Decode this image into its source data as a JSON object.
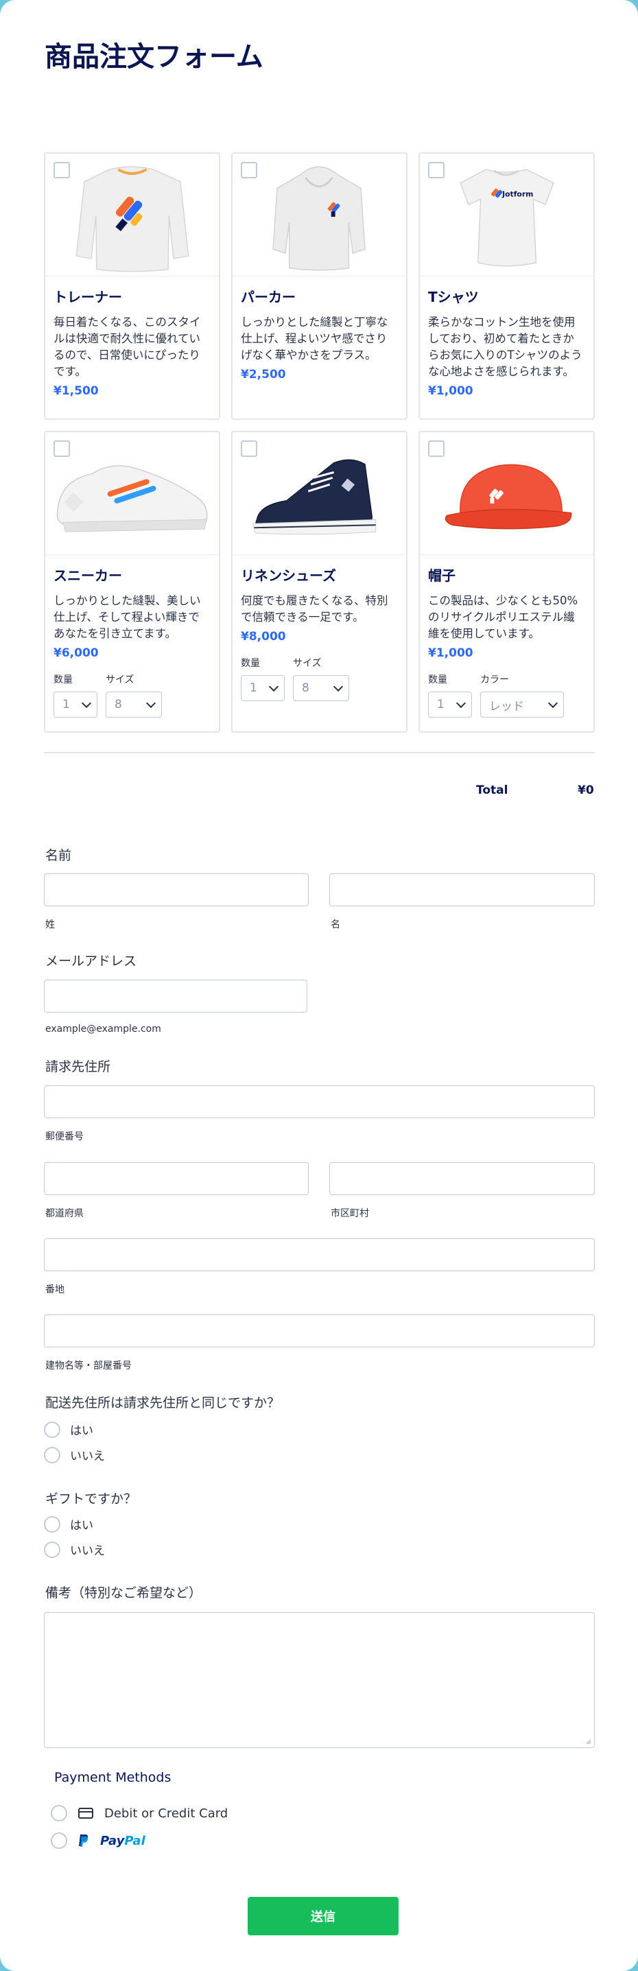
{
  "form": {
    "title": "商品注文フォーム"
  },
  "products": [
    {
      "name": "トレーナー",
      "desc": "毎日着たくなる、このスタイルは快適で耐久性に優れているので、日常使いにぴったりです。",
      "price": "¥1,500",
      "image": "sweatshirt"
    },
    {
      "name": "パーカー",
      "desc": "しっかりとした縫製と丁寧な仕上げ、程よいツヤ感でさりげなく華やかさをプラス。",
      "price": "¥2,500",
      "image": "hoodie"
    },
    {
      "name": "Tシャツ",
      "desc": "柔らかなコットン生地を使用しており、初めて着たときからお気に入りのTシャツのような心地よさを感じられます。",
      "price": "¥1,000",
      "image": "tshirt",
      "logo_text": "Jotform"
    },
    {
      "name": "スニーカー",
      "desc": "しっかりとした縫製、美しい仕上げ、そして程よい輝きであなたを引き立てます。",
      "price": "¥6,000",
      "image": "sneaker",
      "options": [
        {
          "label": "数量",
          "value": "1"
        },
        {
          "label": "サイズ",
          "value": "8"
        }
      ]
    },
    {
      "name": "リネンシューズ",
      "desc": "何度でも履きたくなる、特別で信頼できる一足です。",
      "price": "¥8,000",
      "image": "high-top-shoe",
      "options": [
        {
          "label": "数量",
          "value": "1"
        },
        {
          "label": "サイズ",
          "value": "8"
        }
      ]
    },
    {
      "name": "帽子",
      "desc": "この製品は、少なくとも50%のリサイクルポリエステル繊維を使用しています。",
      "price": "¥1,000",
      "image": "cap",
      "options": [
        {
          "label": "数量",
          "value": "1"
        },
        {
          "label": "カラー",
          "value": "レッド"
        }
      ]
    }
  ],
  "total": {
    "label": "Total",
    "value": "¥0"
  },
  "name_field": {
    "label": "名前",
    "last": "姓",
    "first": "名"
  },
  "email_field": {
    "label": "メールアドレス",
    "hint": "example@example.com"
  },
  "address_field": {
    "label": "請求先住所",
    "postal": "郵便番号",
    "prefecture": "都道府県",
    "city": "市区町村",
    "street": "番地",
    "building": "建物名等・部屋番号"
  },
  "shipping_same": {
    "label": "配送先住所は請求先住所と同じですか？",
    "options": [
      "はい",
      "いいえ"
    ]
  },
  "gift": {
    "label": "ギフトですか？",
    "options": [
      "はい",
      "いいえ"
    ]
  },
  "notes": {
    "label": "備考（特別なご希望など）"
  },
  "payment": {
    "title": "Payment Methods",
    "card_label": "Debit or Credit Card",
    "paypal_pay": "Pay",
    "paypal_pal": "Pal"
  },
  "submit_label": "送信",
  "colors": {
    "accent": "#2e69ff",
    "submit": "#18bd5b",
    "border": "#c3cad8",
    "backdrop": "#6fc6dd",
    "cap": "#f0533a"
  }
}
